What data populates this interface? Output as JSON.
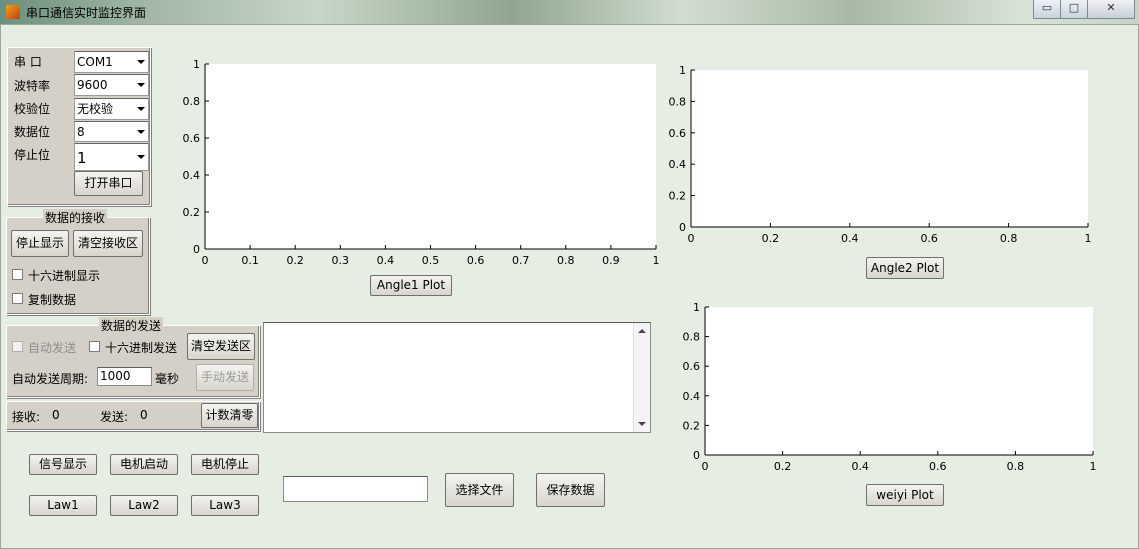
{
  "window": {
    "title": "串口通信实时监控界面",
    "controls": {
      "minimize": "▭",
      "maximize": "□",
      "close": "✕"
    }
  },
  "serial_config": {
    "port_label": "串  口",
    "port_value": "COM1",
    "baud_label": "波特率",
    "baud_value": "9600",
    "parity_label": "校验位",
    "parity_value": "无校验",
    "databits_label": "数据位",
    "databits_value": "8",
    "stopbits_label": "停止位",
    "stopbits_value": "1",
    "open_button": "打开串口"
  },
  "receive": {
    "title": "数据的接收",
    "stop_display_button": "停止显示",
    "clear_receive_button": "清空接收区",
    "hex_display_label": "十六进制显示",
    "copy_data_label": "复制数据"
  },
  "send": {
    "title": "数据的发送",
    "auto_send_label": "自动发送",
    "hex_send_label": "十六进制发送",
    "clear_send_button": "清空发送区",
    "period_label": "自动发送周期:",
    "period_value": "1000",
    "period_unit": "毫秒",
    "manual_send_button": "手动发送"
  },
  "counters": {
    "receive_label": "接收:",
    "receive_value": "0",
    "send_label": "发送:",
    "send_value": "0",
    "reset_button": "计数清零"
  },
  "controls": {
    "signal_display": "信号显示",
    "motor_start": "电机启动",
    "motor_stop": "电机停止",
    "law1": "Law1",
    "law2": "Law2",
    "law3": "Law3",
    "file_path_value": "",
    "choose_file": "选择文件",
    "save_data": "保存数据"
  },
  "chart_data": [
    {
      "type": "line",
      "name_button": "Angle1 Plot",
      "series": [],
      "xlim": [
        0,
        1
      ],
      "ylim": [
        0,
        1
      ],
      "xticks": [
        "0",
        "0.1",
        "0.2",
        "0.3",
        "0.4",
        "0.5",
        "0.6",
        "0.7",
        "0.8",
        "0.9",
        "1"
      ],
      "yticks": [
        "0",
        "0.2",
        "0.4",
        "0.6",
        "0.8",
        "1"
      ]
    },
    {
      "type": "line",
      "name_button": "Angle2 Plot",
      "series": [],
      "xlim": [
        0,
        1
      ],
      "ylim": [
        0,
        1
      ],
      "xticks": [
        "0",
        "0.2",
        "0.4",
        "0.6",
        "0.8",
        "1"
      ],
      "yticks": [
        "0",
        "0.2",
        "0.4",
        "0.6",
        "0.8",
        "1"
      ]
    },
    {
      "type": "line",
      "name_button": "weiyi Plot",
      "series": [],
      "xlim": [
        0,
        1
      ],
      "ylim": [
        0,
        1
      ],
      "xticks": [
        "0",
        "0.2",
        "0.4",
        "0.6",
        "0.8",
        "1"
      ],
      "yticks": [
        "0",
        "0.2",
        "0.4",
        "0.6",
        "0.8",
        "1"
      ]
    }
  ]
}
